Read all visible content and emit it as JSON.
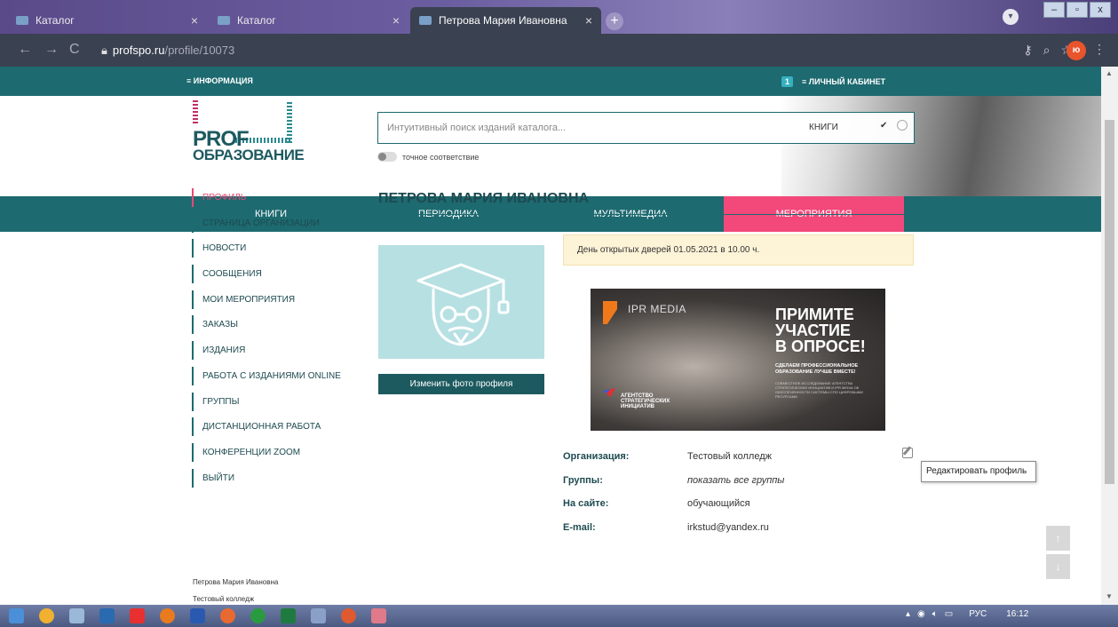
{
  "browser": {
    "tabs": [
      {
        "label": "Каталог",
        "close": "×"
      },
      {
        "label": "Каталог",
        "close": "×"
      },
      {
        "label": "Петрова Мария Ивановна",
        "close": "×"
      }
    ],
    "new_tab": "+",
    "profile_badge": "ю",
    "url_host": "profspo.ru",
    "url_path": "/profile/10073",
    "window_buttons": [
      "–",
      "▫",
      "x"
    ]
  },
  "site": {
    "top_strip": {
      "info": "≡ ИНФОРМАЦИЯ",
      "notif_count": "1",
      "cabinet": "≡ ЛИЧНЫЙ КАБИНЕТ"
    },
    "logo": {
      "line1": "PROF",
      "line2": "ОБРАЗОВАНИЕ"
    },
    "search": {
      "placeholder": "Интуитивный поиск изданий каталога...",
      "scope": "КНИГИ",
      "exact_match": "точное соответствие"
    },
    "nav": [
      "КНИГИ",
      "ПЕРИОДИКА",
      "МУЛЬТИМЕДИА",
      "МЕРОПРИЯТИЯ"
    ]
  },
  "sidebar": {
    "items": [
      {
        "label": "ПРОФИЛЬ",
        "active": true
      },
      {
        "label": "СТРАНИЦА ОРГАНИЗАЦИИ"
      },
      {
        "label": "НОВОСТИ"
      },
      {
        "label": "СООБЩЕНИЯ"
      },
      {
        "label": "МОИ МЕРОПРИЯТИЯ"
      },
      {
        "label": "ЗАКАЗЫ"
      },
      {
        "label": "ИЗДАНИЯ"
      },
      {
        "label": "РАБОТА С ИЗДАНИЯМИ ONLINE"
      },
      {
        "label": "ГРУППЫ"
      },
      {
        "label": "ДИСТАНЦИОННАЯ РАБОТА"
      },
      {
        "label": "КОНФЕРЕНЦИИ ZOOM"
      },
      {
        "label": "ВЫЙТИ"
      }
    ],
    "user_name": "Петрова Мария Ивановна",
    "user_org": "Тестовый колледж"
  },
  "profile": {
    "title": "ПЕТРОВА МАРИЯ ИВАНОВНА",
    "change_photo": "Изменить фото профиля",
    "notice": "День открытых дверей 01.05.2021 в 10.00 ч.",
    "banner": {
      "brand": "IPR MEDIA",
      "headline": [
        "ПРИМИТЕ",
        "УЧАСТИЕ",
        "В ОПРОСЕ!"
      ],
      "sub": "СДЕЛАЕМ ПРОФЕССИОНАЛЬНОЕ ОБРАЗОВАНИЕ ЛУЧШЕ ВМЕСТЕ!",
      "fine_print": "СОВМЕСТНОЕ ИССЛЕДОВАНИЕ АГЕНТСТВА СТРАТЕГИЧЕСКИХ ИНИЦИАТИВ И IPR MEDIA ОБ ОБЕСПЕЧЕННОСТИ СИСТЕМЫ СПО ЦИФРОВЫМИ РЕСУРСАМИ",
      "asi": [
        "АГЕНТСТВО",
        "СТРАТЕГИЧЕСКИХ",
        "ИНИЦИАТИВ"
      ]
    },
    "fields": [
      {
        "key": "Организация:",
        "value": "Тестовый колледж"
      },
      {
        "key": "Группы:",
        "value": "показать все группы"
      },
      {
        "key": "На сайте:",
        "value": "обучающийся"
      },
      {
        "key": "E-mail:",
        "value": "irkstud@yandex.ru"
      }
    ],
    "tooltip": "Редактировать профиль",
    "scroll_up": "↑",
    "scroll_down": "↓"
  },
  "taskbar": {
    "lang": "РУС",
    "time": "16:12"
  }
}
